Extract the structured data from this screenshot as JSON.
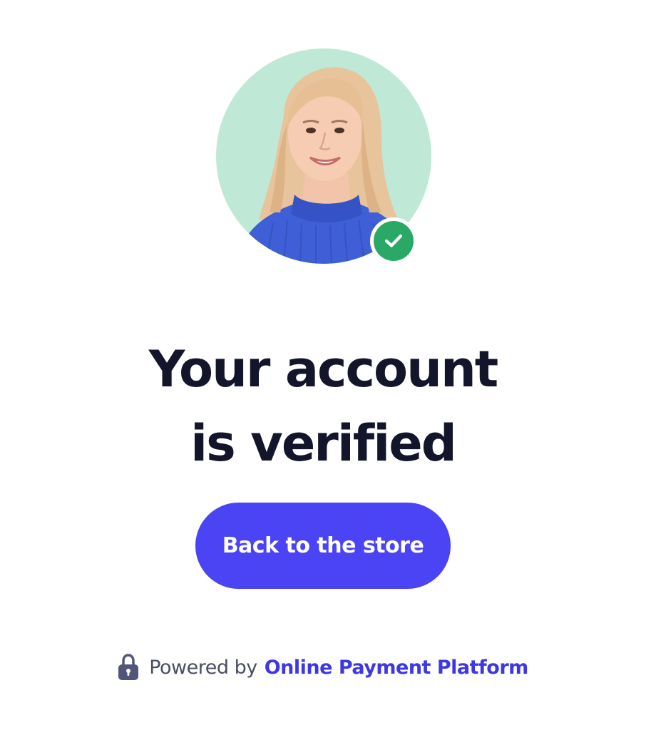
{
  "avatar": {
    "alt": "Verified user portrait",
    "background_color": "#bfe9d6",
    "badge_color": "#2aa865",
    "badge_icon": "checkmark-icon"
  },
  "title": {
    "line1": "Your account",
    "line2": "is verified"
  },
  "cta": {
    "label": "Back to the store",
    "color": "#4a44f5"
  },
  "footer": {
    "lock_icon": "lock-icon",
    "powered_by": "Powered by",
    "brand": "Online Payment Platform",
    "brand_color": "#3d37e6"
  }
}
